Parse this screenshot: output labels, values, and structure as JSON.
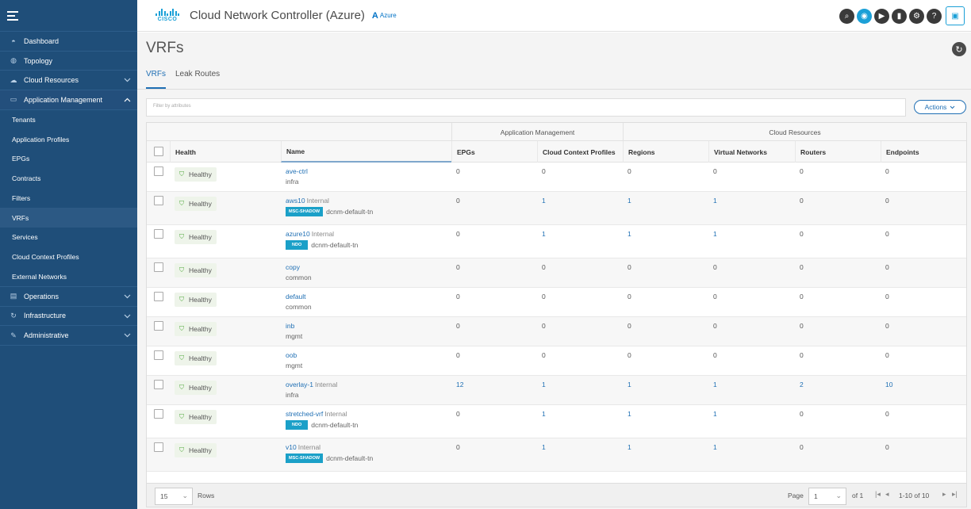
{
  "header": {
    "title": "Cloud Network Controller (Azure)",
    "logo_text": "CISCO",
    "azure_label": "Azure"
  },
  "sidebar": {
    "items": [
      {
        "label": "Dashboard",
        "icon": "dashboard-icon"
      },
      {
        "label": "Topology",
        "icon": "globe-icon"
      },
      {
        "label": "Cloud Resources",
        "icon": "cloud-icon"
      },
      {
        "label": "Application Management",
        "icon": "app-icon"
      }
    ],
    "sub_items": [
      "Tenants",
      "Application Profiles",
      "EPGs",
      "Contracts",
      "Filters",
      "VRFs",
      "Services",
      "Cloud Context Profiles",
      "External Networks"
    ],
    "bottom_items": [
      {
        "label": "Operations",
        "icon": "operations-icon"
      },
      {
        "label": "Infrastructure",
        "icon": "infrastructure-icon"
      },
      {
        "label": "Administrative",
        "icon": "wrench-icon"
      }
    ]
  },
  "page": {
    "title": "VRFs",
    "tabs": [
      "VRFs",
      "Leak Routes"
    ],
    "filter_placeholder": "Filter by attributes",
    "actions_label": "Actions"
  },
  "table": {
    "groups": [
      "Application Management",
      "Cloud Resources"
    ],
    "columns": [
      "Health",
      "Name",
      "EPGs",
      "Cloud Context Profiles",
      "Regions",
      "Virtual Networks",
      "Routers",
      "Endpoints"
    ],
    "rows": [
      {
        "health": "Healthy",
        "name": "ave-ctrl",
        "internal": "",
        "badge": "",
        "tenant": "infra",
        "epgs": "0",
        "ccp": "0",
        "regions": "0",
        "vnets": "0",
        "routers": "0",
        "endpoints": "0"
      },
      {
        "health": "Healthy",
        "name": "aws10",
        "internal": "Internal",
        "badge": "MSC-SHADOW",
        "tenant": "dcnm-default-tn",
        "epgs": "0",
        "ccp": "1",
        "regions": "1",
        "vnets": "1",
        "routers": "0",
        "endpoints": "0"
      },
      {
        "health": "Healthy",
        "name": "azure10",
        "internal": "Internal",
        "badge": "NDO",
        "tenant": "dcnm-default-tn",
        "epgs": "0",
        "ccp": "1",
        "regions": "1",
        "vnets": "1",
        "routers": "0",
        "endpoints": "0"
      },
      {
        "health": "Healthy",
        "name": "copy",
        "internal": "",
        "badge": "",
        "tenant": "common",
        "epgs": "0",
        "ccp": "0",
        "regions": "0",
        "vnets": "0",
        "routers": "0",
        "endpoints": "0"
      },
      {
        "health": "Healthy",
        "name": "default",
        "internal": "",
        "badge": "",
        "tenant": "common",
        "epgs": "0",
        "ccp": "0",
        "regions": "0",
        "vnets": "0",
        "routers": "0",
        "endpoints": "0"
      },
      {
        "health": "Healthy",
        "name": "inb",
        "internal": "",
        "badge": "",
        "tenant": "mgmt",
        "epgs": "0",
        "ccp": "0",
        "regions": "0",
        "vnets": "0",
        "routers": "0",
        "endpoints": "0"
      },
      {
        "health": "Healthy",
        "name": "oob",
        "internal": "",
        "badge": "",
        "tenant": "mgmt",
        "epgs": "0",
        "ccp": "0",
        "regions": "0",
        "vnets": "0",
        "routers": "0",
        "endpoints": "0"
      },
      {
        "health": "Healthy",
        "name": "overlay-1",
        "internal": "Internal",
        "badge": "",
        "tenant": "infra",
        "epgs": "12",
        "ccp": "1",
        "regions": "1",
        "vnets": "1",
        "routers": "2",
        "endpoints": "10"
      },
      {
        "health": "Healthy",
        "name": "stretched-vrf",
        "internal": "Internal",
        "badge": "NDO",
        "tenant": "dcnm-default-tn",
        "epgs": "0",
        "ccp": "1",
        "regions": "1",
        "vnets": "1",
        "routers": "0",
        "endpoints": "0"
      },
      {
        "health": "Healthy",
        "name": "v10",
        "internal": "Internal",
        "badge": "MSC-SHADOW",
        "tenant": "dcnm-default-tn",
        "epgs": "0",
        "ccp": "1",
        "regions": "1",
        "vnets": "1",
        "routers": "0",
        "endpoints": "0"
      }
    ]
  },
  "footer": {
    "rows_value": "15",
    "rows_label": "Rows",
    "page_label": "Page",
    "page_value": "1",
    "of_label": "of 1",
    "range": "1-10 of 10"
  },
  "colors": {
    "sidebar": "#1f4e79",
    "accent": "#1f6fb4",
    "cisco_blue": "#1ba0d7",
    "healthy": "#4fa83a"
  }
}
